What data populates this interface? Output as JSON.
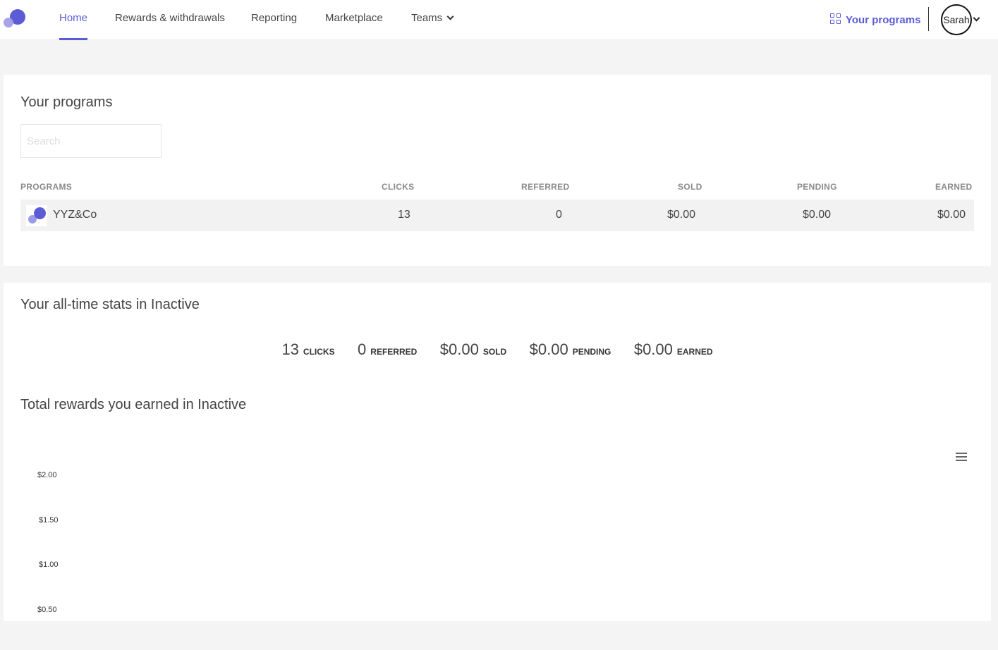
{
  "nav": {
    "items": [
      {
        "label": "Home",
        "active": true
      },
      {
        "label": "Rewards & withdrawals"
      },
      {
        "label": "Reporting"
      },
      {
        "label": "Marketplace"
      },
      {
        "label": "Teams",
        "dropdown": true
      }
    ],
    "your_programs_label": "Your programs",
    "user_label": "Sarah",
    "accent_color": "#5b5bd6"
  },
  "programs_card": {
    "title": "Your programs",
    "search_placeholder": "Search",
    "columns": [
      "PROGRAMS",
      "CLICKS",
      "REFERRED",
      "SOLD",
      "PENDING",
      "EARNED"
    ],
    "rows": [
      {
        "program": "YYZ&Co",
        "clicks": "13",
        "referred": "0",
        "sold": "$0.00",
        "pending": "$0.00",
        "earned": "$0.00"
      }
    ]
  },
  "stats_card": {
    "title": "Your all-time stats in Inactive",
    "stats": [
      {
        "value": "13",
        "label": "CLICKS"
      },
      {
        "value": "0",
        "label": "REFERRED"
      },
      {
        "value": "$0.00",
        "label": "SOLD"
      },
      {
        "value": "$0.00",
        "label": "PENDING"
      },
      {
        "value": "$0.00",
        "label": "EARNED"
      }
    ],
    "rewards_title": "Total rewards you earned in Inactive"
  },
  "chart_data": {
    "type": "line",
    "title": "",
    "xlabel": "",
    "ylabel": "",
    "y_ticks": [
      "$2.00",
      "$1.50",
      "$1.00",
      "$0.50"
    ],
    "series": []
  }
}
